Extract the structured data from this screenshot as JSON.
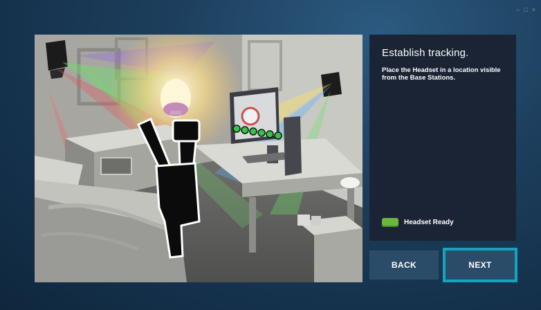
{
  "window": {
    "controls": {
      "minimize": "–",
      "maximize": "□",
      "close": "×"
    }
  },
  "illustration": {
    "description_icon": "room-tracking-illustration"
  },
  "panel": {
    "title": "Establish tracking.",
    "description": "Place the Headset in a location visible from the Base Stations.",
    "status": {
      "label": "Headset Ready",
      "color": "#6cb83d"
    }
  },
  "buttons": {
    "back": "BACK",
    "next": "NEXT"
  },
  "colors": {
    "accent": "#15a3bd",
    "panel": "#1a2434",
    "button": "#2b4c68"
  }
}
